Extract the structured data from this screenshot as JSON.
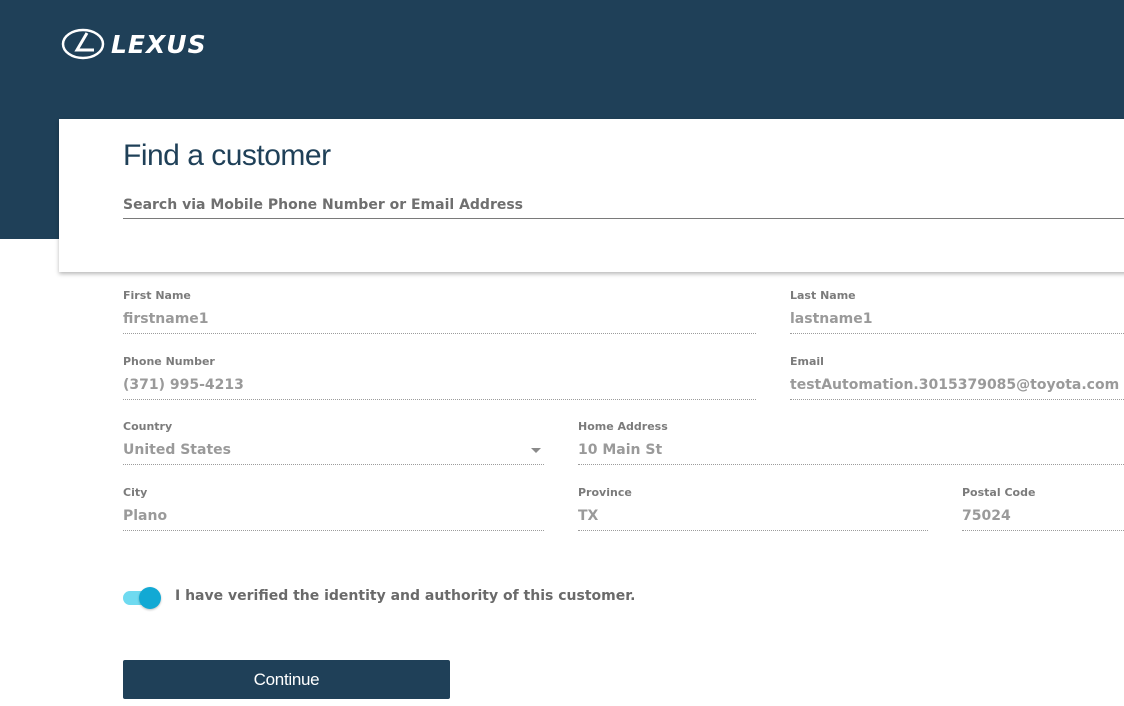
{
  "header": {
    "brand": "LEXUS",
    "logo_icon": "lexus-logo-icon",
    "background": "#1f4058"
  },
  "card": {
    "title": "Find a customer",
    "search_placeholder": "Search via Mobile Phone Number or Email Address"
  },
  "form": {
    "first_name": {
      "label": "First Name",
      "value": "firstname1"
    },
    "last_name": {
      "label": "Last Name",
      "value": "lastname1"
    },
    "phone": {
      "label": "Phone Number",
      "value": "(371) 995-4213"
    },
    "email": {
      "label": "Email",
      "value": "testAutomation.3015379085@toyota.com"
    },
    "country": {
      "label": "Country",
      "value": "United States"
    },
    "home_address": {
      "label": "Home Address",
      "value": "10 Main St"
    },
    "city": {
      "label": "City",
      "value": "Plano"
    },
    "province": {
      "label": "Province",
      "value": "TX"
    },
    "postal_code": {
      "label": "Postal Code",
      "value": "75024"
    }
  },
  "verify": {
    "text": "I have verified the identity and authority of this customer.",
    "on": true,
    "accent": "#12a9d4"
  },
  "actions": {
    "continue_label": "Continue"
  }
}
